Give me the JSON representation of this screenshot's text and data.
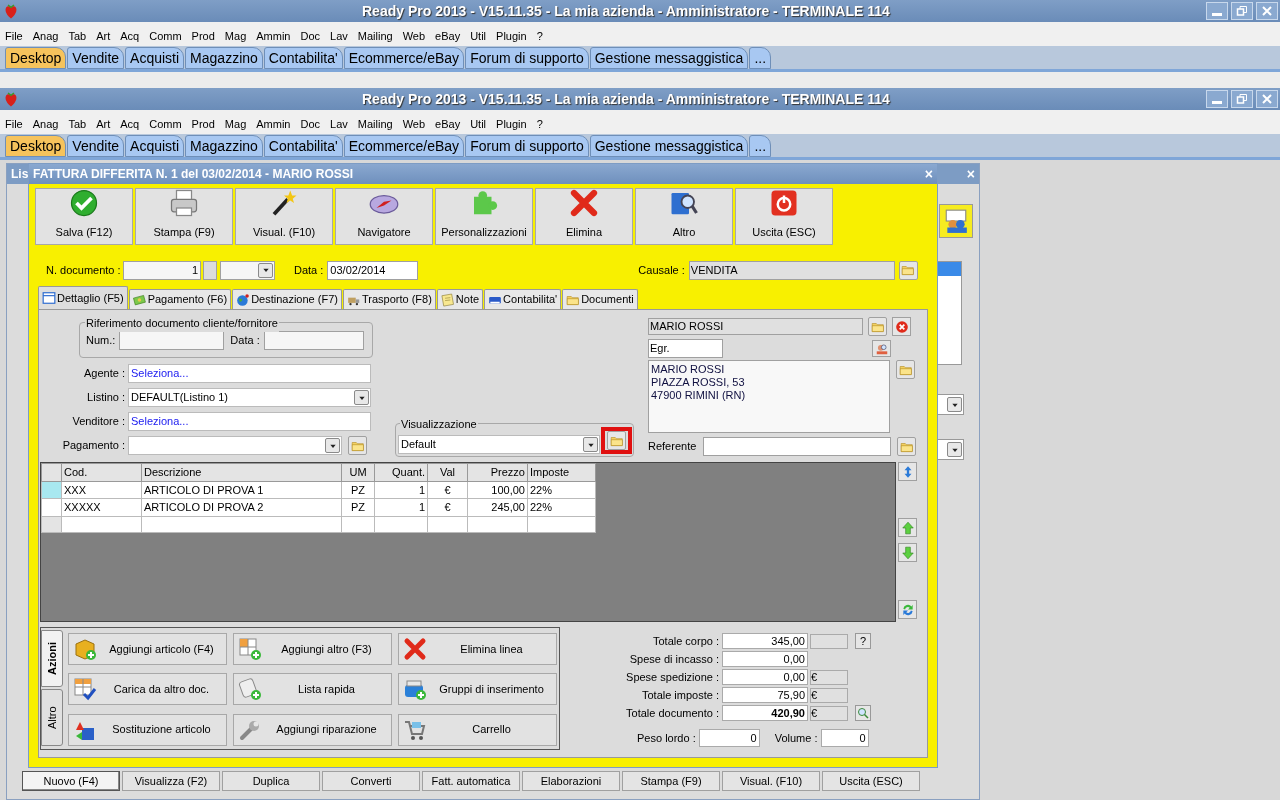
{
  "app_windows": [
    {
      "title": "Ready Pro 2013 - V15.11.35 - La mia azienda - Amministratore - TERMINALE 114",
      "menu": [
        "File",
        "Anag",
        "Tab",
        "Art",
        "Acq",
        "Comm",
        "Prod",
        "Mag",
        "Ammin",
        "Doc",
        "Lav",
        "Mailing",
        "Web",
        "eBay",
        "Util",
        "Plugin",
        "?"
      ],
      "tabs": [
        {
          "label": "Desktop",
          "selected": true
        },
        {
          "label": "Vendite",
          "selected": false
        },
        {
          "label": "Acquisti",
          "selected": false
        },
        {
          "label": "Magazzino",
          "selected": false
        },
        {
          "label": "Contabilita'",
          "selected": false
        },
        {
          "label": "Ecommerce/eBay",
          "selected": false
        },
        {
          "label": "Forum di supporto",
          "selected": false
        },
        {
          "label": "Gestione messaggistica",
          "selected": false
        },
        {
          "label": "...",
          "selected": false
        }
      ]
    },
    {
      "title": "Ready Pro 2013 - V15.11.35 - La mia azienda - Amministratore - TERMINALE 114",
      "menu": [
        "File",
        "Anag",
        "Tab",
        "Art",
        "Acq",
        "Comm",
        "Prod",
        "Mag",
        "Ammin",
        "Doc",
        "Lav",
        "Mailing",
        "Web",
        "eBay",
        "Util",
        "Plugin",
        "?"
      ],
      "tabs": [
        {
          "label": "Desktop",
          "selected": true
        },
        {
          "label": "Vendite",
          "selected": false
        },
        {
          "label": "Acquisti",
          "selected": false
        },
        {
          "label": "Magazzino",
          "selected": false
        },
        {
          "label": "Contabilita'",
          "selected": false
        },
        {
          "label": "Ecommerce/eBay",
          "selected": false
        },
        {
          "label": "Forum di supporto",
          "selected": false
        },
        {
          "label": "Gestione messaggistica",
          "selected": false
        },
        {
          "label": "...",
          "selected": false
        }
      ]
    }
  ],
  "background_window": {
    "title": "Lis",
    "close": "×",
    "buttons": [
      {
        "label": "Nuovo (F4)",
        "selected": true
      },
      {
        "label": "Visualizza (F2)",
        "selected": false
      },
      {
        "label": "Duplica",
        "selected": false
      },
      {
        "label": "Converti",
        "selected": false
      },
      {
        "label": "Fatt. automatica",
        "selected": false
      },
      {
        "label": "Elaborazioni",
        "selected": false
      },
      {
        "label": "Stampa (F9)",
        "selected": false
      },
      {
        "label": "Visual. (F10)",
        "selected": false
      },
      {
        "label": "Uscita (ESC)",
        "selected": false
      }
    ]
  },
  "dialog": {
    "title": "FATTURA DIFFERITA N. 1 del 03/02/2014 - MARIO ROSSI",
    "close": "×",
    "toolbar": [
      {
        "label": "Salva (F12)",
        "kind": "check"
      },
      {
        "label": "Stampa (F9)",
        "kind": "printer"
      },
      {
        "label": "Visual. (F10)",
        "kind": "wand"
      },
      {
        "label": "Navigatore",
        "kind": "compass"
      },
      {
        "label": "Personalizzazioni",
        "kind": "puzzle"
      },
      {
        "label": "Elimina",
        "kind": "cross"
      },
      {
        "label": "Altro",
        "kind": "booksearch"
      },
      {
        "label": "Uscita (ESC)",
        "kind": "power"
      }
    ],
    "header": {
      "doc_number_label": "N. documento :",
      "doc_number": "1",
      "date_label": "Data :",
      "date": "03/02/2014",
      "causale_label": "Causale :",
      "causale": "VENDITA"
    },
    "tabs": [
      {
        "label": "Dettaglio (F5)",
        "kind": "calendar",
        "selected": true
      },
      {
        "label": "Pagamento (F6)",
        "kind": "money",
        "selected": false
      },
      {
        "label": "Destinazione (F7)",
        "kind": "globe",
        "selected": false
      },
      {
        "label": "Trasporto (F8)",
        "kind": "truck",
        "selected": false
      },
      {
        "label": "Note",
        "kind": "note",
        "selected": false
      },
      {
        "label": "Contabilita'",
        "kind": "book",
        "selected": false
      },
      {
        "label": "Documenti",
        "kind": "folder",
        "selected": false
      }
    ],
    "reference": {
      "legend": "Riferimento documento cliente/fornitore",
      "num_label": "Num.:",
      "date_label": "Data :"
    },
    "fields": [
      {
        "label": "Agente :",
        "value": "Seleziona...",
        "kind": "link"
      },
      {
        "label": "Listino :",
        "value": "DEFAULT(Listino 1)",
        "kind": "dropdown"
      },
      {
        "label": "Venditore :",
        "value": "Seleziona...",
        "kind": "link"
      },
      {
        "label": "Pagamento :",
        "kind": "dropdown_folder"
      }
    ],
    "view": {
      "legend": "Visualizzazione",
      "value": "Default",
      "highlighted": true
    },
    "customer": {
      "name": "MARIO ROSSI",
      "salutation": "Egr.",
      "address": [
        "MARIO ROSSI",
        "PIAZZA ROSSI, 53",
        "47900 RIMINI (RN)"
      ],
      "referente_label": "Referente"
    },
    "table": {
      "columns": [
        "Cod.",
        "Descrizione",
        "UM",
        "Quant.",
        "Val",
        "Prezzo",
        "Imposte"
      ],
      "rows": [
        {
          "selected": true,
          "cells": [
            "XXX",
            "ARTICOLO DI PROVA 1",
            "PZ",
            "1",
            "€",
            "100,00",
            "22%"
          ]
        },
        {
          "selected": false,
          "cells": [
            "XXXXX",
            "ARTICOLO DI PROVA 2",
            "PZ",
            "1",
            "€",
            "245,00",
            "22%"
          ]
        }
      ]
    },
    "actions": {
      "side_tabs": [
        {
          "label": "Azioni",
          "selected": true
        },
        {
          "label": "Altro",
          "selected": false
        }
      ],
      "buttons": [
        {
          "label": "Aggiungi articolo (F4)",
          "kind": "boxplus"
        },
        {
          "label": "Aggiungi altro (F3)",
          "kind": "gridplus"
        },
        {
          "label": "Elimina linea",
          "kind": "cross"
        },
        {
          "label": "Carica da altro doc.",
          "kind": "gridcheck"
        },
        {
          "label": "Lista rapida",
          "kind": "scrollplus"
        },
        {
          "label": "Gruppi di inserimento",
          "kind": "basketplus"
        },
        {
          "label": "Sostituzione articolo",
          "kind": "swap"
        },
        {
          "label": "Aggiungi riparazione",
          "kind": "wrench"
        },
        {
          "label": "Carrello",
          "kind": "cart"
        }
      ]
    },
    "totals": [
      {
        "label": "Totale corpo :",
        "value": "345,00",
        "kind": "help",
        "extra": "?"
      },
      {
        "label": "Spese di incasso :",
        "value": "0,00",
        "kind": "plain"
      },
      {
        "label": "Spese spedizione :",
        "value": "0,00",
        "kind": "currency",
        "extra": "€"
      },
      {
        "label": "Totale imposte :",
        "value": "75,90",
        "kind": "currency",
        "extra": "€"
      },
      {
        "label": "Totale documento :",
        "value": "420,90",
        "kind": "grand",
        "extra": "€"
      }
    ],
    "measures": [
      {
        "label": "Peso lordo :",
        "value": "0"
      },
      {
        "label": "Volume :",
        "value": "0"
      }
    ]
  }
}
